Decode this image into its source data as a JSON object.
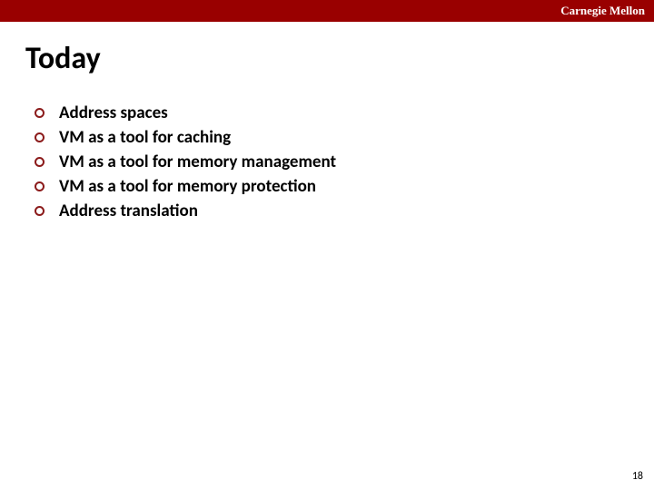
{
  "header": {
    "brand": "Carnegie Mellon"
  },
  "title": "Today",
  "bullets": {
    "item0": "Address spaces",
    "item1": "VM as a tool for caching",
    "item2": "VM as a tool for memory management",
    "item3": "VM as a tool for memory protection",
    "item4": "Address translation"
  },
  "page_number": "18"
}
